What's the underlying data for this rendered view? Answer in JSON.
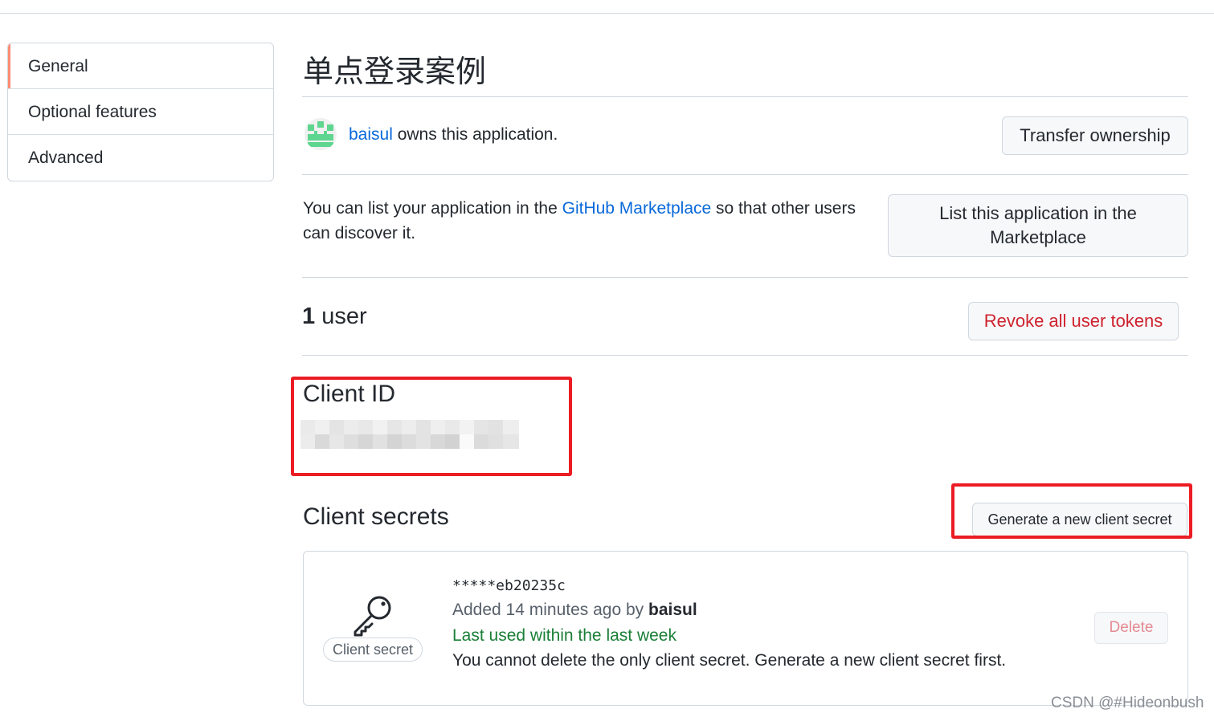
{
  "sidebar": {
    "items": [
      {
        "label": "General",
        "active": true
      },
      {
        "label": "Optional features",
        "active": false
      },
      {
        "label": "Advanced",
        "active": false
      }
    ]
  },
  "app": {
    "title": "单点登录案例",
    "owner": "baisul",
    "owns_suffix": " owns this application.",
    "transfer_label": "Transfer ownership"
  },
  "marketplace": {
    "text_before": "You can list your application in the ",
    "link_text": "GitHub Marketplace",
    "text_after": " so that other users can discover it.",
    "button_label": "List this application in the Marketplace"
  },
  "users": {
    "count": "1",
    "suffix": " user",
    "revoke_label": "Revoke all user tokens"
  },
  "client_id": {
    "title": "Client ID"
  },
  "client_secrets": {
    "title": "Client secrets",
    "generate_label": "Generate a new client secret",
    "items": [
      {
        "badge": "Client secret",
        "masked_value": "*****eb20235c",
        "added_prefix": "Added 14 minutes ago by ",
        "added_by": "baisul",
        "last_used": "Last used within the last week",
        "note": "You cannot delete the only client secret. Generate a new client secret first.",
        "delete_label": "Delete"
      }
    ]
  },
  "watermark": "CSDN @#Hideonbush",
  "colors": {
    "link": "#0969da",
    "danger": "#cf222e",
    "success": "#1a7f37",
    "annotation_box": "#ec1c24",
    "active_indicator": "#fd8c73"
  }
}
